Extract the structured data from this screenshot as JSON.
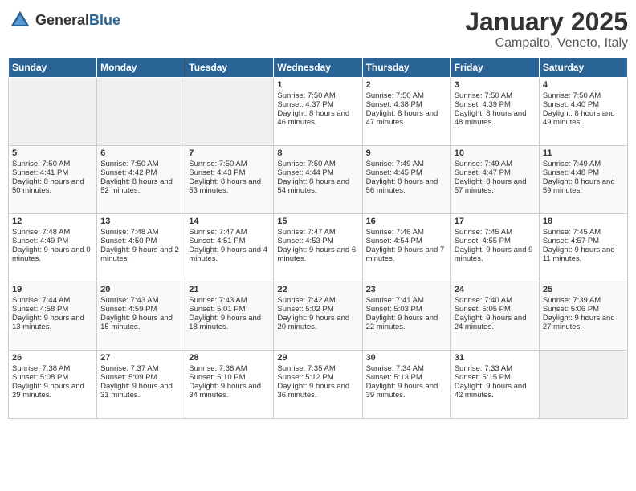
{
  "header": {
    "logo_general": "General",
    "logo_blue": "Blue",
    "cal_title": "January 2025",
    "cal_subtitle": "Campalto, Veneto, Italy"
  },
  "days_of_week": [
    "Sunday",
    "Monday",
    "Tuesday",
    "Wednesday",
    "Thursday",
    "Friday",
    "Saturday"
  ],
  "weeks": [
    [
      {
        "day": "",
        "empty": true
      },
      {
        "day": "",
        "empty": true
      },
      {
        "day": "",
        "empty": true
      },
      {
        "day": "1",
        "sunrise": "Sunrise: 7:50 AM",
        "sunset": "Sunset: 4:37 PM",
        "daylight": "Daylight: 8 hours and 46 minutes."
      },
      {
        "day": "2",
        "sunrise": "Sunrise: 7:50 AM",
        "sunset": "Sunset: 4:38 PM",
        "daylight": "Daylight: 8 hours and 47 minutes."
      },
      {
        "day": "3",
        "sunrise": "Sunrise: 7:50 AM",
        "sunset": "Sunset: 4:39 PM",
        "daylight": "Daylight: 8 hours and 48 minutes."
      },
      {
        "day": "4",
        "sunrise": "Sunrise: 7:50 AM",
        "sunset": "Sunset: 4:40 PM",
        "daylight": "Daylight: 8 hours and 49 minutes."
      }
    ],
    [
      {
        "day": "5",
        "sunrise": "Sunrise: 7:50 AM",
        "sunset": "Sunset: 4:41 PM",
        "daylight": "Daylight: 8 hours and 50 minutes."
      },
      {
        "day": "6",
        "sunrise": "Sunrise: 7:50 AM",
        "sunset": "Sunset: 4:42 PM",
        "daylight": "Daylight: 8 hours and 52 minutes."
      },
      {
        "day": "7",
        "sunrise": "Sunrise: 7:50 AM",
        "sunset": "Sunset: 4:43 PM",
        "daylight": "Daylight: 8 hours and 53 minutes."
      },
      {
        "day": "8",
        "sunrise": "Sunrise: 7:50 AM",
        "sunset": "Sunset: 4:44 PM",
        "daylight": "Daylight: 8 hours and 54 minutes."
      },
      {
        "day": "9",
        "sunrise": "Sunrise: 7:49 AM",
        "sunset": "Sunset: 4:45 PM",
        "daylight": "Daylight: 8 hours and 56 minutes."
      },
      {
        "day": "10",
        "sunrise": "Sunrise: 7:49 AM",
        "sunset": "Sunset: 4:47 PM",
        "daylight": "Daylight: 8 hours and 57 minutes."
      },
      {
        "day": "11",
        "sunrise": "Sunrise: 7:49 AM",
        "sunset": "Sunset: 4:48 PM",
        "daylight": "Daylight: 8 hours and 59 minutes."
      }
    ],
    [
      {
        "day": "12",
        "sunrise": "Sunrise: 7:48 AM",
        "sunset": "Sunset: 4:49 PM",
        "daylight": "Daylight: 9 hours and 0 minutes."
      },
      {
        "day": "13",
        "sunrise": "Sunrise: 7:48 AM",
        "sunset": "Sunset: 4:50 PM",
        "daylight": "Daylight: 9 hours and 2 minutes."
      },
      {
        "day": "14",
        "sunrise": "Sunrise: 7:47 AM",
        "sunset": "Sunset: 4:51 PM",
        "daylight": "Daylight: 9 hours and 4 minutes."
      },
      {
        "day": "15",
        "sunrise": "Sunrise: 7:47 AM",
        "sunset": "Sunset: 4:53 PM",
        "daylight": "Daylight: 9 hours and 6 minutes."
      },
      {
        "day": "16",
        "sunrise": "Sunrise: 7:46 AM",
        "sunset": "Sunset: 4:54 PM",
        "daylight": "Daylight: 9 hours and 7 minutes."
      },
      {
        "day": "17",
        "sunrise": "Sunrise: 7:45 AM",
        "sunset": "Sunset: 4:55 PM",
        "daylight": "Daylight: 9 hours and 9 minutes."
      },
      {
        "day": "18",
        "sunrise": "Sunrise: 7:45 AM",
        "sunset": "Sunset: 4:57 PM",
        "daylight": "Daylight: 9 hours and 11 minutes."
      }
    ],
    [
      {
        "day": "19",
        "sunrise": "Sunrise: 7:44 AM",
        "sunset": "Sunset: 4:58 PM",
        "daylight": "Daylight: 9 hours and 13 minutes."
      },
      {
        "day": "20",
        "sunrise": "Sunrise: 7:43 AM",
        "sunset": "Sunset: 4:59 PM",
        "daylight": "Daylight: 9 hours and 15 minutes."
      },
      {
        "day": "21",
        "sunrise": "Sunrise: 7:43 AM",
        "sunset": "Sunset: 5:01 PM",
        "daylight": "Daylight: 9 hours and 18 minutes."
      },
      {
        "day": "22",
        "sunrise": "Sunrise: 7:42 AM",
        "sunset": "Sunset: 5:02 PM",
        "daylight": "Daylight: 9 hours and 20 minutes."
      },
      {
        "day": "23",
        "sunrise": "Sunrise: 7:41 AM",
        "sunset": "Sunset: 5:03 PM",
        "daylight": "Daylight: 9 hours and 22 minutes."
      },
      {
        "day": "24",
        "sunrise": "Sunrise: 7:40 AM",
        "sunset": "Sunset: 5:05 PM",
        "daylight": "Daylight: 9 hours and 24 minutes."
      },
      {
        "day": "25",
        "sunrise": "Sunrise: 7:39 AM",
        "sunset": "Sunset: 5:06 PM",
        "daylight": "Daylight: 9 hours and 27 minutes."
      }
    ],
    [
      {
        "day": "26",
        "sunrise": "Sunrise: 7:38 AM",
        "sunset": "Sunset: 5:08 PM",
        "daylight": "Daylight: 9 hours and 29 minutes."
      },
      {
        "day": "27",
        "sunrise": "Sunrise: 7:37 AM",
        "sunset": "Sunset: 5:09 PM",
        "daylight": "Daylight: 9 hours and 31 minutes."
      },
      {
        "day": "28",
        "sunrise": "Sunrise: 7:36 AM",
        "sunset": "Sunset: 5:10 PM",
        "daylight": "Daylight: 9 hours and 34 minutes."
      },
      {
        "day": "29",
        "sunrise": "Sunrise: 7:35 AM",
        "sunset": "Sunset: 5:12 PM",
        "daylight": "Daylight: 9 hours and 36 minutes."
      },
      {
        "day": "30",
        "sunrise": "Sunrise: 7:34 AM",
        "sunset": "Sunset: 5:13 PM",
        "daylight": "Daylight: 9 hours and 39 minutes."
      },
      {
        "day": "31",
        "sunrise": "Sunrise: 7:33 AM",
        "sunset": "Sunset: 5:15 PM",
        "daylight": "Daylight: 9 hours and 42 minutes."
      },
      {
        "day": "",
        "empty": true
      }
    ]
  ]
}
